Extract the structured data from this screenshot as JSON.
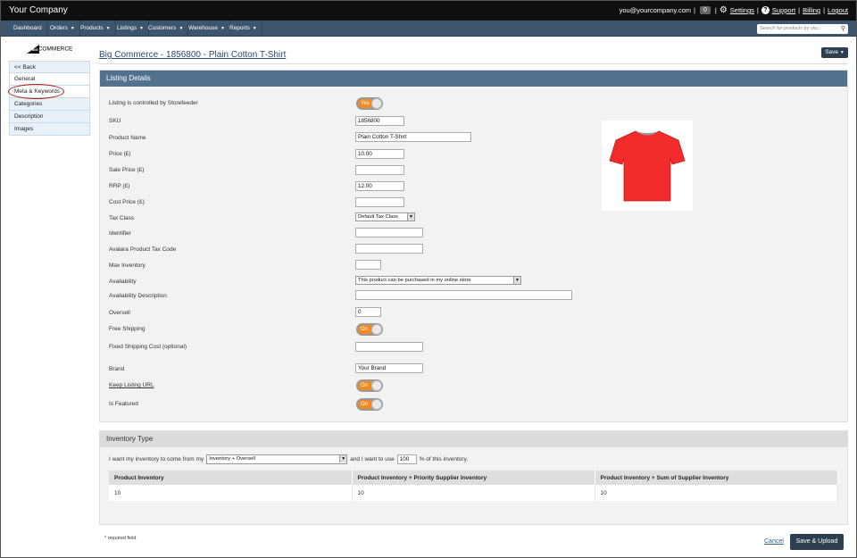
{
  "header": {
    "brand": "Your Company",
    "email": "you@yourcompany.com",
    "count": "0",
    "settings": "Settings",
    "support": "Support",
    "billing": "Billing",
    "logout": "Logout",
    "sep": "|"
  },
  "nav": {
    "items": [
      "Dashboard",
      "Orders",
      "Products",
      "Listings",
      "Customers",
      "Warehouse",
      "Reports"
    ],
    "search_placeholder": "Search for products by sku..."
  },
  "sidebar": {
    "logo_small": "BIG",
    "logo_text": "COMMERCE",
    "items": [
      "<< Back",
      "General",
      "Meta & Keywords",
      "Categories",
      "Description",
      "Images"
    ]
  },
  "page": {
    "title": "Big Commerce - 1856800 - Plain Cotton T-Shirt",
    "save": "Save"
  },
  "listing": {
    "heading": "Listing Details",
    "fields": {
      "controlled": {
        "label": "Listing is controlled by Storefeeder",
        "value": "Yes"
      },
      "sku": {
        "label": "SKU",
        "value": "1856800"
      },
      "name": {
        "label": "Product Name",
        "value": "Plain Cotton T-Shirt"
      },
      "price": {
        "label": "Price (£)",
        "value": "10.00"
      },
      "sale": {
        "label": "Sale Price (£)",
        "value": ""
      },
      "rrp": {
        "label": "RRP (£)",
        "value": "12.00"
      },
      "cost": {
        "label": "Cost Price (£)",
        "value": ""
      },
      "tax": {
        "label": "Tax Class",
        "value": "Default Tax Class"
      },
      "identifier": {
        "label": "Identifier",
        "value": ""
      },
      "avalara": {
        "label": "Avalara Product Tax Code",
        "value": ""
      },
      "maxinv": {
        "label": "Max Inventory",
        "value": ""
      },
      "availability": {
        "label": "Availability",
        "value": "This product can be purchased in my online store"
      },
      "availdesc": {
        "label": "Availability Description",
        "value": ""
      },
      "oversell": {
        "label": "Oversell",
        "value": "0"
      },
      "freeship": {
        "label": "Free Shipping",
        "value": "On"
      },
      "fixedship": {
        "label": "Fixed Shipping Cost (optional)",
        "value": ""
      },
      "brand": {
        "label": "Brand",
        "value": "Your Brand"
      },
      "keepurl": {
        "label": "Keep Listing URL",
        "value": "On"
      },
      "featured": {
        "label": "Is Featured",
        "value": "On"
      }
    }
  },
  "inventory": {
    "heading": "Inventory Type",
    "text1": "I want my inventory to come from my",
    "source": "Inventory + Oversell",
    "text2": "and I want to use",
    "percent": "100",
    "text3": "% of this inventory.",
    "columns": [
      "Product Inventory",
      "Product Inventory + Priority Supplier Inventory",
      "Product Inventory + Sum of Supplier Inventory"
    ],
    "rows": [
      [
        "10",
        "10",
        "10"
      ]
    ]
  },
  "footer": {
    "required": "* required field",
    "cancel": "Cancel",
    "save_upload": "Save & Upload"
  },
  "colors": {
    "navbar": "#3d566e",
    "panel_head": "#52718f",
    "toggle_on": "#f08a24",
    "button": "#2c3e50",
    "tshirt": "#f22b2b"
  },
  "icons": [
    "gear-icon",
    "help-icon",
    "search-icon",
    "caret-down-icon",
    "tshirt-image"
  ]
}
